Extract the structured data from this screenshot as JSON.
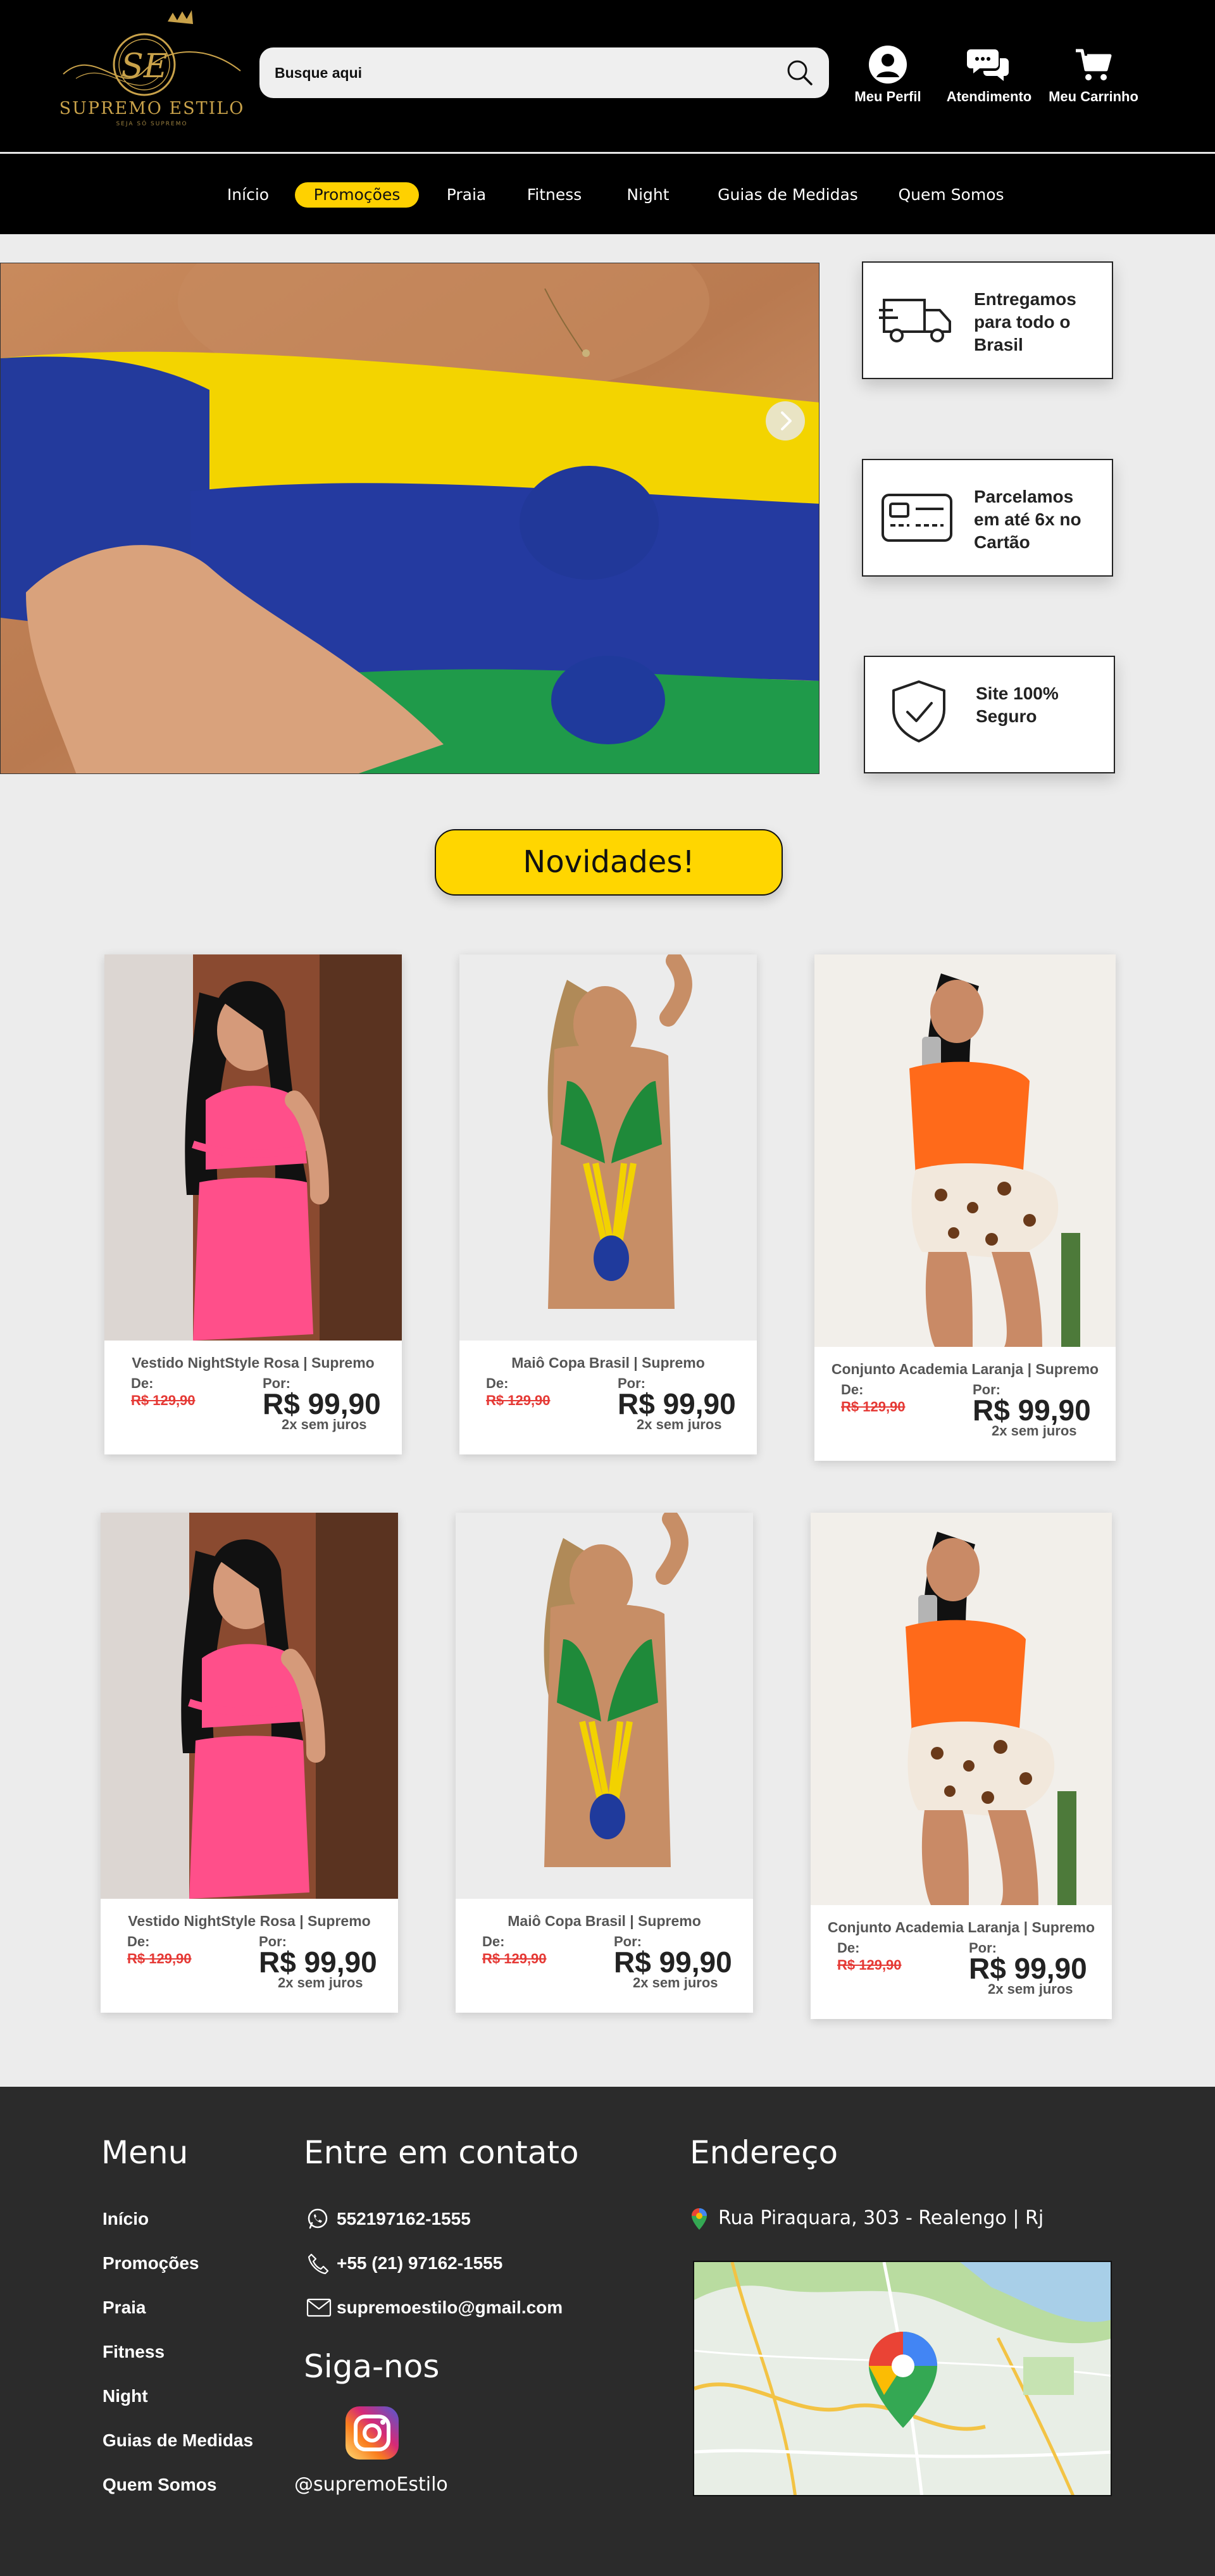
{
  "header": {
    "logo": {
      "text": "SUPREMO ESTILO",
      "monogram": "SE",
      "tagline": "SEJA SÓ SUPREMO"
    },
    "search": {
      "placeholder": "Busque aqui"
    },
    "actions": [
      {
        "label": "Meu Perfil",
        "icon": "user-icon"
      },
      {
        "label": "Atendimento",
        "icon": "chat-icon"
      },
      {
        "label": "Meu Carrinho",
        "icon": "cart-icon"
      }
    ]
  },
  "nav": {
    "items": [
      "Início",
      "Promoções",
      "Praia",
      "Fitness",
      "Night",
      "Guias de Medidas",
      "Quem Somos"
    ],
    "highlight": "Promoções",
    "highlight_color": "#ffd100"
  },
  "hero": {
    "next_icon": "chevron-right-icon"
  },
  "features": [
    {
      "icon": "truck-icon",
      "text": "Entregamos para todo o Brasil"
    },
    {
      "icon": "card-icon",
      "text": "Parcelamos em até 6x no Cartão"
    },
    {
      "icon": "shield-check-icon",
      "text": "Site 100% Seguro"
    }
  ],
  "section_title": "Novidades!",
  "products": [
    {
      "name": "Vestido NightStyle Rosa | Supremo",
      "de_label": "De:",
      "old_price": "R$ 129,90",
      "por_label": "Por:",
      "price": "R$ 99,90",
      "installments": "2x sem juros"
    },
    {
      "name": "Maiô Copa Brasil | Supremo",
      "de_label": "De:",
      "old_price": "R$ 129,90",
      "por_label": "Por:",
      "price": "R$ 99,90",
      "installments": "2x sem juros"
    },
    {
      "name": "Conjunto Academia Laranja | Supremo",
      "de_label": "De:",
      "old_price": "R$ 129,90",
      "por_label": "Por:",
      "price": "R$ 99,90",
      "installments": "2x sem juros"
    },
    {
      "name": "Vestido NightStyle Rosa | Supremo",
      "de_label": "De:",
      "old_price": "R$ 129,90",
      "por_label": "Por:",
      "price": "R$ 99,90",
      "installments": "2x sem juros"
    },
    {
      "name": "Maiô Copa Brasil | Supremo",
      "de_label": "De:",
      "old_price": "R$ 129,90",
      "por_label": "Por:",
      "price": "R$ 99,90",
      "installments": "2x sem juros"
    },
    {
      "name": "Conjunto Academia Laranja | Supremo",
      "de_label": "De:",
      "old_price": "R$ 129,90",
      "por_label": "Por:",
      "price": "R$ 99,90",
      "installments": "2x sem juros"
    }
  ],
  "footer": {
    "menu_title": "Menu",
    "menu_items": [
      "Início",
      "Promoções",
      "Praia",
      "Fitness",
      "Night",
      "Guias de Medidas",
      "Quem Somos"
    ],
    "contact_title": "Entre em contato",
    "whatsapp": "552197162-1555",
    "phone": "+55 (21) 97162-1555",
    "email": "supremoestilo@gmail.com",
    "follow_title": "Siga-nos",
    "instagram_handle": "@supremoEstilo",
    "address_title": "Endereço",
    "address": "Rua Piraquara, 303 - Realengo | Rj"
  },
  "colors": {
    "accent": "#ffd100",
    "header_bg": "#000000",
    "footer_bg": "#2b2b2b",
    "old_price": "#e53935"
  }
}
